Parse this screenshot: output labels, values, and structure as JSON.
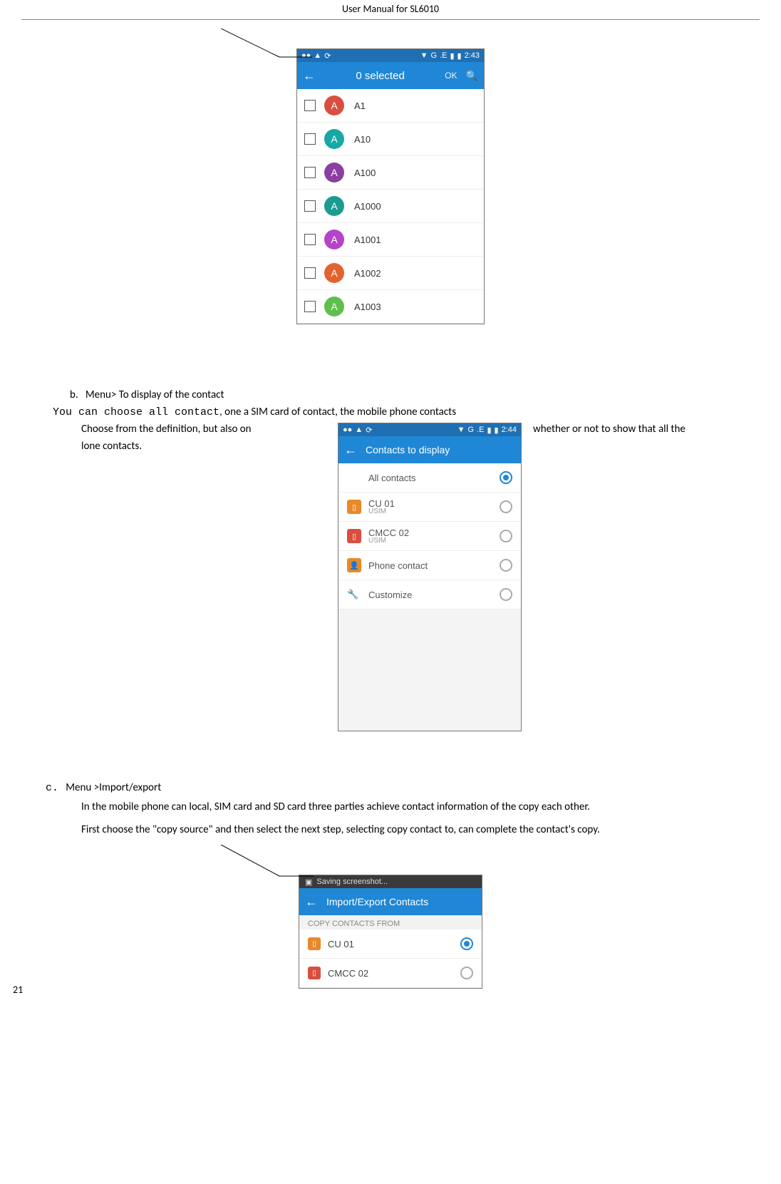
{
  "doc": {
    "header_title": "User Manual for SL6010",
    "page_number": "21"
  },
  "phone1": {
    "status_time": "2:43",
    "status_net": "G",
    "status_ind": ".E",
    "appbar_title": "0 selected",
    "appbar_ok": "OK",
    "contacts": [
      {
        "name": "A1",
        "initial": "A",
        "colorClass": "c-red"
      },
      {
        "name": "A10",
        "initial": "A",
        "colorClass": "c-cyan"
      },
      {
        "name": "A100",
        "initial": "A",
        "colorClass": "c-purple"
      },
      {
        "name": "A1000",
        "initial": "A",
        "colorClass": "c-teal"
      },
      {
        "name": "A1001",
        "initial": "A",
        "colorClass": "c-mag"
      },
      {
        "name": "A1002",
        "initial": "A",
        "colorClass": "c-orange"
      },
      {
        "name": "A1003",
        "initial": "A",
        "colorClass": "c-green"
      }
    ]
  },
  "section_b": {
    "label": "b.",
    "title": "Menu> To display of the contact",
    "line1_prefix": "You can choose all contact",
    "line1_rest": ", one a SIM card of contact, the mobile phone contacts",
    "line2_pre": "Choose from the definition, but also on",
    "line2_post": "whether or not to show that all the",
    "line3": "lone contacts."
  },
  "phone2": {
    "status_time": "2:44",
    "status_net": "G",
    "status_ind": ".E",
    "appbar_title": "Contacts to display",
    "rows": [
      {
        "label": "All contacts",
        "sub": "",
        "icon": "none",
        "selected": true
      },
      {
        "label": "CU 01",
        "sub": "USIM",
        "icon": "sim-orange",
        "selected": false
      },
      {
        "label": "CMCC 02",
        "sub": "USIM",
        "icon": "sim-red",
        "selected": false
      },
      {
        "label": "Phone contact",
        "sub": "",
        "icon": "person",
        "selected": false
      },
      {
        "label": "Customize",
        "sub": "",
        "icon": "wrench",
        "selected": false
      }
    ]
  },
  "section_c": {
    "label": "c.",
    "title": "Menu >Import/export",
    "para1": "In the mobile phone can local, SIM card and SD card three parties achieve contact information of the copy each other.",
    "para2": "First choose the \"copy source\" and then select the next step, selecting copy contact to, can complete the contact's copy."
  },
  "phone3": {
    "toast": "Saving screenshot...",
    "appbar_title": "Import/Export Contacts",
    "section_label": "COPY CONTACTS FROM",
    "rows": [
      {
        "label": "CU 01",
        "colorClass": "sq-orange",
        "selected": true
      },
      {
        "label": "CMCC 02",
        "colorClass": "sq-red",
        "selected": false
      }
    ]
  }
}
